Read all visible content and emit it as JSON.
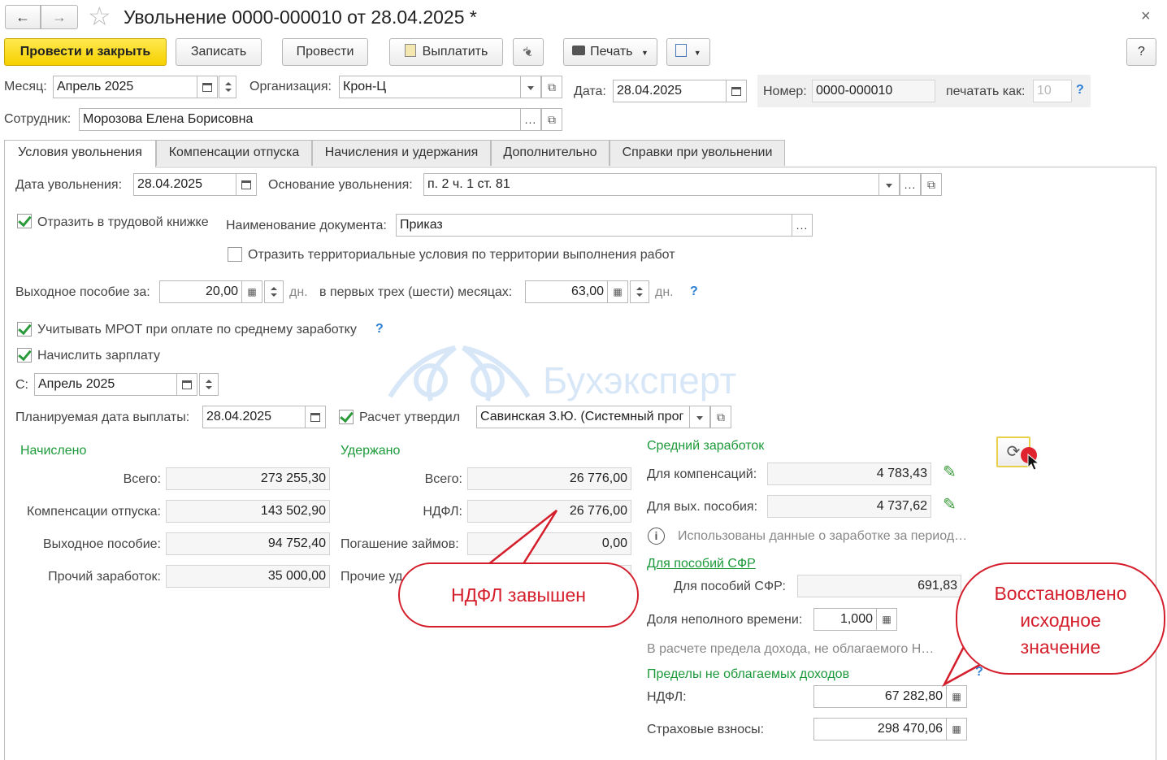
{
  "window": {
    "title": "Увольнение 0000-000010 от 28.04.2025 *"
  },
  "toolbar": {
    "post_close": "Провести и закрыть",
    "save": "Записать",
    "post": "Провести",
    "pay": "Выплатить",
    "print": "Печать",
    "help": "?"
  },
  "header": {
    "month_label": "Месяц:",
    "month_value": "Апрель 2025",
    "org_label": "Организация:",
    "org_value": "Крон-Ц",
    "date_label": "Дата:",
    "date_value": "28.04.2025",
    "number_label": "Номер:",
    "number_value": "0000-000010",
    "print_as_label": "печатать как:",
    "print_as_value": "10",
    "employee_label": "Сотрудник:",
    "employee_value": "Морозова Елена Борисовна"
  },
  "tabs": [
    "Условия увольнения",
    "Компенсации отпуска",
    "Начисления и удержания",
    "Дополнительно",
    "Справки при увольнении"
  ],
  "conditions": {
    "dismissal_date_label": "Дата увольнения:",
    "dismissal_date": "28.04.2025",
    "reason_label": "Основание увольнения:",
    "reason_value": "п. 2 ч. 1 ст. 81",
    "workbook_label": "Отразить в трудовой книжке",
    "doc_name_label": "Наименование документа:",
    "doc_name_value": "Приказ",
    "territorial_label": "Отразить территориальные условия по территории выполнения работ",
    "severance_label": "Выходное пособие за:",
    "severance_days": "20,00",
    "days_unit": "дн.",
    "first_months_label": "в первых трех (шести) месяцах:",
    "first_months_days": "63,00",
    "mrot_label": "Учитывать МРОТ при оплате по среднему заработку",
    "accrue_salary_label": "Начислить зарплату",
    "from_label": "С:",
    "from_value": "Апрель 2025",
    "planned_pay_label": "Планируемая дата выплаты:",
    "planned_pay_date": "28.04.2025",
    "approved_label": "Расчет утвердил",
    "approved_value": "Савинская З.Ю. (Системный прог"
  },
  "accrued": {
    "title": "Начислено",
    "total_label": "Всего:",
    "total": "273 255,30",
    "vacation_label": "Компенсации отпуска:",
    "vacation": "143 502,90",
    "severance_label": "Выходное пособие:",
    "severance": "94 752,40",
    "other_label": "Прочий заработок:",
    "other": "35 000,00"
  },
  "withheld": {
    "title": "Удержано",
    "total_label": "Всего:",
    "total": "26 776,00",
    "ndfl_label": "НДФЛ:",
    "ndfl": "26 776,00",
    "loans_label": "Погашение займов:",
    "loans": "0,00",
    "other_label": "Прочие уд"
  },
  "average": {
    "title": "Средний заработок",
    "comp_label": "Для компенсаций:",
    "comp": "4 783,43",
    "severance_label": "Для вых. пособия:",
    "severance": "4 737,62",
    "info_text": "Использованы данные о заработке за период…",
    "sfr_link": "Для пособий СФР",
    "sfr_label": "Для пособий СФР:",
    "sfr": "691,83",
    "part_time_label": "Доля неполного времени:",
    "part_time": "1,000",
    "limit_note": "В расчете предела дохода, не облагаемого Н…"
  },
  "limits": {
    "title": "Пределы не облагаемых доходов",
    "ndfl_label": "НДФЛ:",
    "ndfl": "67 282,80",
    "insurance_label": "Страховые взносы:",
    "insurance": "298 470,06"
  },
  "watermark": "Бухэксперт",
  "callouts": {
    "ndfl_high": "НДФЛ завышен",
    "restored_line1": "Восстановлено",
    "restored_line2": "исходное",
    "restored_line3": "значение"
  },
  "colors": {
    "primary_button": "#f6d000",
    "section_title": "#1c9a3a",
    "callout": "#d41e2b",
    "help": "#2b7fd4"
  }
}
